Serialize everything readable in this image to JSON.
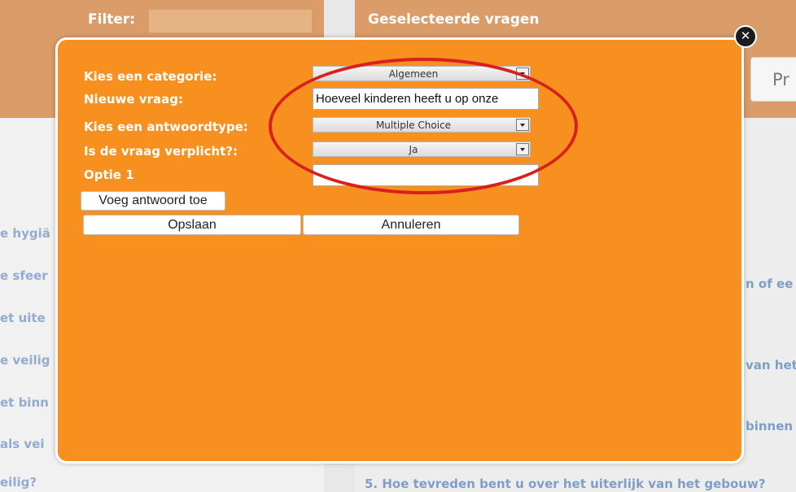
{
  "background": {
    "filter_label": "Filter:",
    "selected_title": "Geselecteerde vragen",
    "pr_button_label": "Pr",
    "left_questions": [
      "e hygiä",
      "e sfeer",
      "et uite",
      "e veilig",
      "et binn",
      "als vei",
      "eilig?"
    ],
    "right_questions": [
      "n of ee",
      "van het",
      "binnen"
    ],
    "bottom_question": "5.   Hoe tevreden bent u over het uiterlijk van het gebouw?"
  },
  "modal": {
    "close_icon": "close-x-icon",
    "fields": {
      "category_label": "Kies een categorie:",
      "category_value": "Algemeen",
      "new_question_label": "Nieuwe vraag:",
      "new_question_value": "Hoeveel kinderen heeft u op onze",
      "answer_type_label": "Kies een antwoordtype:",
      "answer_type_value": "Multiple Choice",
      "required_label": "Is de vraag verplicht?:",
      "required_value": "Ja",
      "option1_label": "Optie 1",
      "option1_value": ""
    },
    "buttons": {
      "add_answer": "Voeg antwoord toe",
      "save": "Opslaan",
      "cancel": "Annuleren"
    }
  },
  "colors": {
    "modal_bg": "#f7901e",
    "header_bg": "#c7671a",
    "annotation": "#d8211f"
  }
}
